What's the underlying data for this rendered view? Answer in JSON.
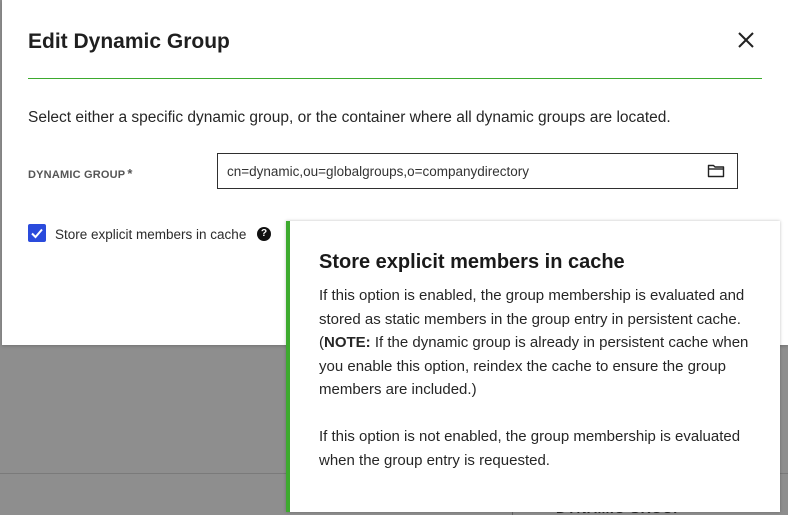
{
  "dialog": {
    "title": "Edit Dynamic Group",
    "description": "Select either a specific dynamic group, or the container where all dynamic groups are located.",
    "close_icon": "close-icon"
  },
  "dynamic_group": {
    "label": "DYNAMIC GROUP",
    "required_mark": "*",
    "value": "cn=dynamic,ou=globalgroups,o=companydirectory",
    "browse_icon": "folder-icon"
  },
  "cache_option": {
    "checked": true,
    "label": "Store explicit members in cache",
    "help_icon": "help-icon",
    "help_glyph": "?"
  },
  "tooltip": {
    "title": "Store explicit members in cache",
    "para1_pre": "If this option is enabled, the group membership is evaluated and stored as static members in the group entry in persistent cache. (",
    "para1_note": "NOTE:",
    "para1_post": " If the dynamic group is already in persistent cache when you enable this option, reindex the cache to ensure the group members are included.)",
    "para2": "If this option is not enabled, the group membership is evaluated when the group entry is requested."
  },
  "background": {
    "partial_text": "DYNAMIC GROUP"
  },
  "colors": {
    "accent_green": "#3daa2e",
    "checkbox_blue": "#2a4bdc",
    "overlay_gray": "#8e8e8e"
  }
}
